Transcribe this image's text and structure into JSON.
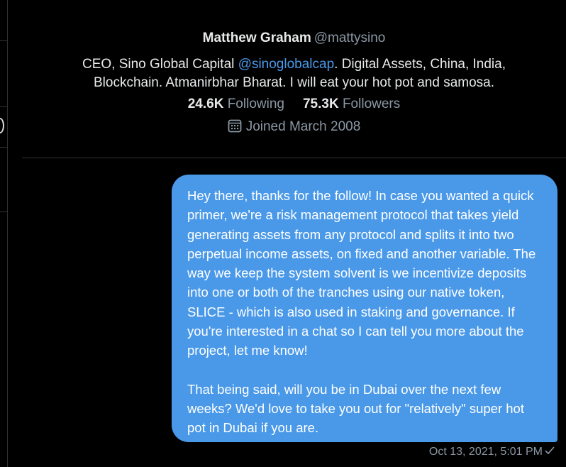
{
  "profile": {
    "display_name": "Matthew Graham",
    "handle": "@mattysino",
    "bio_prefix": "CEO, Sino Global Capital ",
    "bio_mention": "@sinoglobalcap",
    "bio_suffix": ". Digital Assets, China, India, Blockchain. Atmanirbhar Bharat. I will eat your hot pot and samosa.",
    "following_count": "24.6K",
    "following_label": "Following",
    "followers_count": "75.3K",
    "followers_label": "Followers",
    "joined": "Joined March 2008",
    "joined_icon": "calendar-icon"
  },
  "message": {
    "paragraph_1": "Hey there, thanks for the follow! In case you wanted a quick primer, we're a risk management protocol that takes yield generating assets from any protocol and splits it into two perpetual income assets, on fixed and another variable. The way we keep the system solvent is we incentivize deposits into one or both of the tranches using our native token, SLICE - which is also used in staking and governance. If you're interested in a chat so I can tell you more about the project, let me know!",
    "paragraph_2": "That being said, will you be in Dubai over the next few weeks? We'd love to take you out for \"relatively\" super hot pot in Dubai if you are.",
    "timestamp": "Oct 13, 2021, 5:01 PM",
    "status_icon": "checkmark-icon"
  },
  "colors": {
    "background": "#000000",
    "bubble": "#4a99e9",
    "mention": "#4a99e9",
    "muted_text": "#8b98a5",
    "primary_text": "#e7e9ea"
  }
}
